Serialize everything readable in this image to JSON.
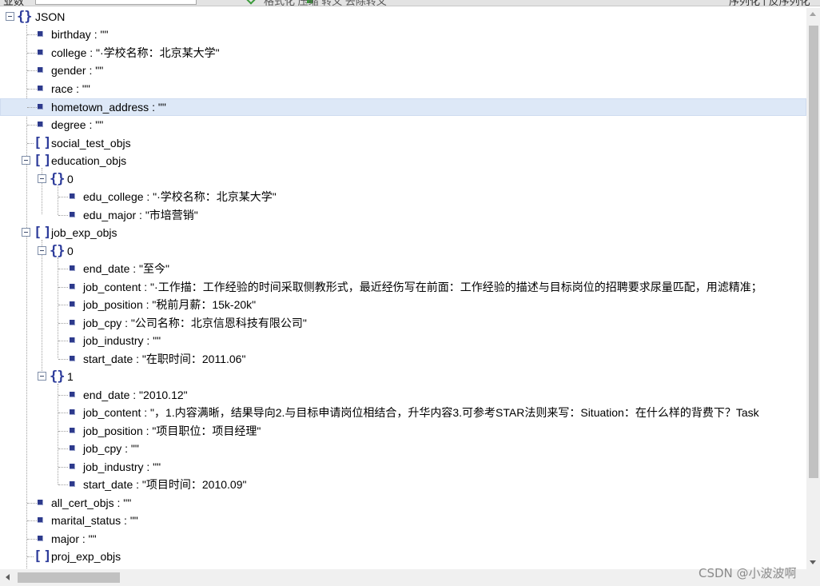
{
  "toolbar": {
    "left_fragment": "业数",
    "middle_fragment": "格式化  压缩  转义  去除转义",
    "right_fragment": "序列化 | 反序列化"
  },
  "tree": {
    "root_label": "JSON",
    "nodes": [
      {
        "label": "birthday : \"\""
      },
      {
        "label": "college : \"·学校名称：北京某大学\""
      },
      {
        "label": "gender : \"\""
      },
      {
        "label": "race : \"\""
      },
      {
        "label": "hometown_address : \"\""
      },
      {
        "label": "degree : \"\""
      },
      {
        "label": "social_test_objs"
      },
      {
        "label": "education_objs"
      },
      {
        "label": "0"
      },
      {
        "label": "edu_college : \"·学校名称：北京某大学\""
      },
      {
        "label": "edu_major : \"市培营销\""
      },
      {
        "label": "job_exp_objs"
      },
      {
        "label": "0"
      },
      {
        "label": "end_date : \"至今\""
      },
      {
        "label": "job_content : \"·工作描：工作经验的时间采取侧教形式，最近经伤写在前面：工作经验的描述与目标岗位的招聘要求尿量匹配，用滤精准；"
      },
      {
        "label": "job_position : \"税前月薪：15k-20k\""
      },
      {
        "label": "job_cpy : \"公司名称：北京信恩科技有限公司\""
      },
      {
        "label": "job_industry : \"\""
      },
      {
        "label": "start_date : \"在职时间：2011.06\""
      },
      {
        "label": "1"
      },
      {
        "label": "end_date : \"2010.12\""
      },
      {
        "label": "job_content : \"，1.内容满晰，结果导向2.与目标申请岗位相结合，升华内容3.可参考STAR法则来写：Situation：在什么样的背费下？Task"
      },
      {
        "label": "job_position : \"项目职位：项目经理\""
      },
      {
        "label": "job_cpy : \"\""
      },
      {
        "label": "job_industry : \"\""
      },
      {
        "label": "start_date : \"项目时间：2010.09\""
      },
      {
        "label": "all_cert_objs : \"\""
      },
      {
        "label": "marital_status : \"\""
      },
      {
        "label": "major : \"\""
      },
      {
        "label": "proj_exp_objs"
      }
    ]
  },
  "watermark": "CSDN @小波波啊"
}
